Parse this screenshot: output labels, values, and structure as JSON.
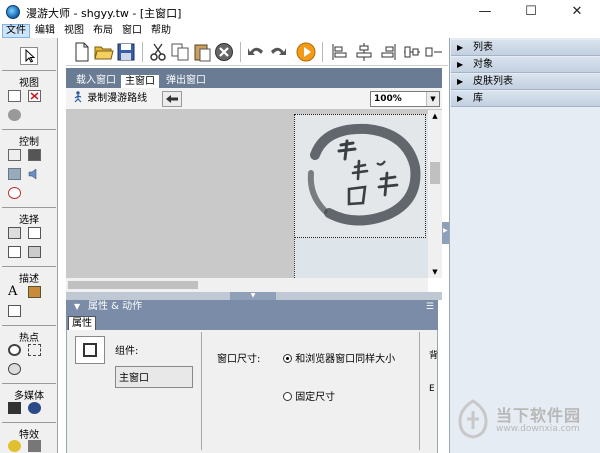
{
  "window": {
    "title": "漫游大师 - shgyy.tw - [主窗口]",
    "minimize": "—",
    "maximize": "☐",
    "close": "✕"
  },
  "menu": [
    "文件",
    "编辑",
    "视图",
    "布局",
    "窗口",
    "帮助"
  ],
  "toolbar_icons": [
    "new-file-icon",
    "open-folder-icon",
    "save-icon",
    "cut-icon",
    "copy-icon",
    "paste-icon",
    "delete-icon",
    "undo-icon",
    "redo-icon",
    "play-icon",
    "align-left-icon",
    "align-center-icon",
    "align-right-icon",
    "align-edge-icon"
  ],
  "toolpanel": {
    "sections": [
      "视图",
      "控制",
      "选择",
      "描述",
      "热点",
      "多媒体",
      "特效"
    ],
    "text_tool": "A"
  },
  "doc_tabs": [
    "载入窗口",
    "主窗口",
    "弹出窗口"
  ],
  "active_doc_tab": "主窗口",
  "subtoolbar": {
    "record_label": "录制漫游路线",
    "zoom_value": "100%"
  },
  "canvas": {
    "logo_text": "古镇之国宴"
  },
  "properties": {
    "header": "属性 & 动作",
    "tab": "属性",
    "component_label": "组件:",
    "component_value": "主窗口",
    "window_size_label": "窗口尺寸:",
    "option_same_as_browser": "和浏览器窗口同样大小",
    "option_fixed": "固定尺寸",
    "right_label_1": "背",
    "right_label_2": "E"
  },
  "right_panel": {
    "rows": [
      "列表",
      "对象",
      "皮肤列表",
      "库"
    ]
  },
  "watermark": {
    "text": "当下软件园",
    "url": "www.downxia.com"
  },
  "colors": {
    "tab_strip": "#6a7c94",
    "header_blue": "#7a8ca8",
    "right_panel_bg": "#e6ecf3",
    "canvas_gray": "#c9c9c9"
  }
}
